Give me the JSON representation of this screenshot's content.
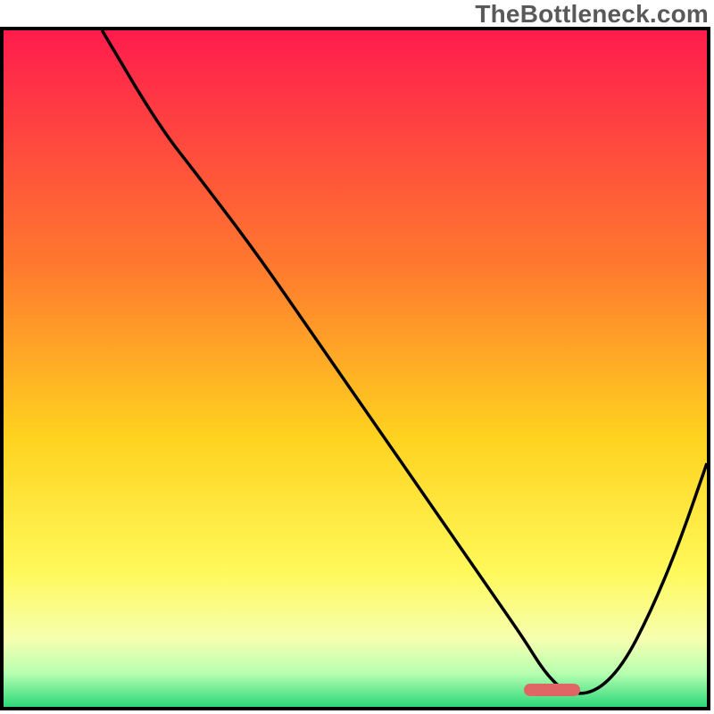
{
  "watermark": "TheBottleneck.com",
  "chart_data": {
    "type": "line",
    "title": "",
    "xlabel": "",
    "ylabel": "",
    "xlim": [
      0,
      100
    ],
    "ylim": [
      0,
      100
    ],
    "grid": false,
    "legend": false,
    "background_gradient": {
      "stops": [
        {
          "offset": 0.0,
          "color": "#ff1c4d"
        },
        {
          "offset": 0.35,
          "color": "#ff7a2e"
        },
        {
          "offset": 0.6,
          "color": "#ffd21f"
        },
        {
          "offset": 0.8,
          "color": "#fff95a"
        },
        {
          "offset": 0.9,
          "color": "#f6ffb0"
        },
        {
          "offset": 0.95,
          "color": "#b7ffb0"
        },
        {
          "offset": 1.0,
          "color": "#2dd87a"
        }
      ]
    },
    "series": [
      {
        "name": "bottleneck-curve",
        "x": [
          14,
          22,
          28,
          36,
          44,
          52,
          60,
          66,
          70,
          74,
          77,
          80,
          84,
          88,
          92,
          96,
          100
        ],
        "y": [
          100,
          86,
          78,
          67,
          55,
          43,
          31,
          22,
          16,
          10,
          5,
          2,
          2,
          6,
          14,
          24,
          36
        ]
      }
    ],
    "annotations": [
      {
        "name": "optimal-marker",
        "shape": "rounded-bar",
        "x_center": 78,
        "width_pct": 8,
        "y": 2.5,
        "color": "#e06666"
      }
    ]
  }
}
